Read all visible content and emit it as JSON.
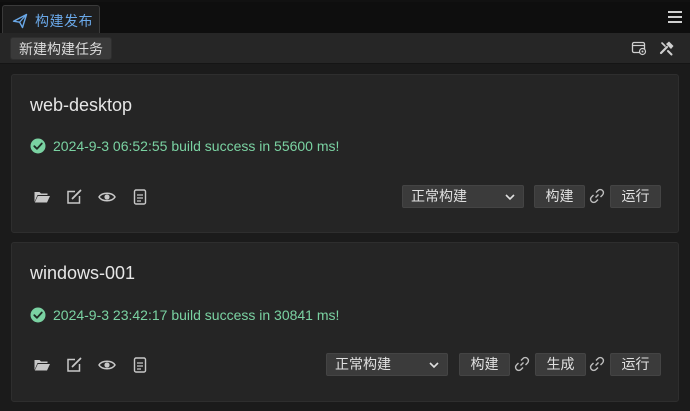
{
  "tab": {
    "title": "构建发布",
    "icon": "paper-plane-icon"
  },
  "header": {
    "menu_icon": "hamburger-menu-icon"
  },
  "toolbar": {
    "new_task_label": "新建构建任务",
    "icons": [
      "template-settings-icon",
      "build-tools-icon"
    ]
  },
  "tasks": [
    {
      "name": "web-desktop",
      "status": "2024-9-3 06:52:55 build success in 55600 ms!",
      "build_mode": "正常构建",
      "buttons": [
        "构建",
        "运行"
      ]
    },
    {
      "name": "windows-001",
      "status": "2024-9-3 23:42:17 build success in 30841 ms!",
      "build_mode": "正常构建",
      "buttons": [
        "构建",
        "生成",
        "运行"
      ]
    }
  ],
  "colors": {
    "accent": "#6aa8e8",
    "success": "#7ad2a2",
    "card_bg": "#252525",
    "button_bg": "#3b3b3b"
  }
}
